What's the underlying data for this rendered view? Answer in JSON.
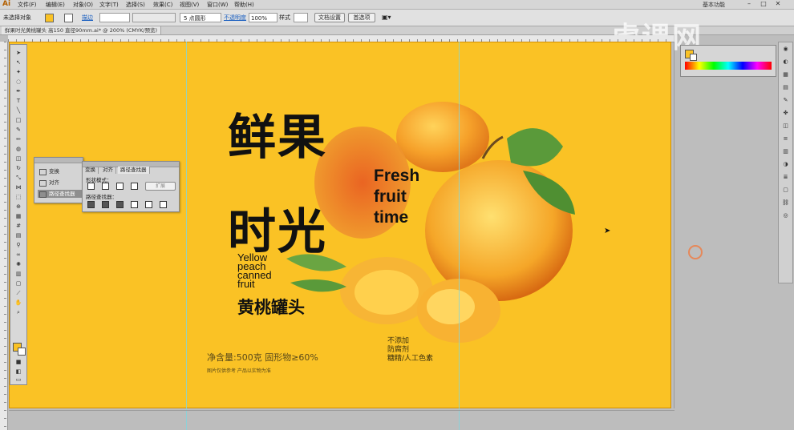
{
  "menubar": {
    "app_icon": "Ai",
    "menus": [
      "文件(F)",
      "编辑(E)",
      "对象(O)",
      "文字(T)",
      "选择(S)",
      "效果(C)",
      "视图(V)",
      "窗口(W)",
      "帮助(H)"
    ],
    "workspace": "基本功能"
  },
  "controlbar": {
    "selection_status": "未选择对象",
    "stroke_label": "描边",
    "point_size": "5 点圆形",
    "opacity_label": "不透明度",
    "opacity_value": "100%",
    "style_label": "样式",
    "doc_setup": "文档设置",
    "preferences": "首选项"
  },
  "document_tab": {
    "title": "鲜果时光黄桃罐头 高150 直径90mm.ai* @ 200% (CMYK/预览)"
  },
  "watermark": "虎课网",
  "transform_panel": {
    "items": [
      "变换",
      "对齐",
      "路径查找器"
    ],
    "selected_index": 2
  },
  "pathfinder_panel": {
    "tabs": [
      "变换",
      "对齐",
      "路径查找器"
    ],
    "active_tab": 2,
    "shape_modes_label": "形状模式：",
    "pathfinders_label": "路径查找器：",
    "expand_button": "扩展"
  },
  "artwork": {
    "title_cn_line1": "鲜果",
    "title_cn_line2": "时光",
    "title_en": [
      "Fresh",
      "fruit",
      "time"
    ],
    "subtitle_en": [
      "Yellow",
      "peach",
      "canned",
      "fruit"
    ],
    "subtitle_cn": "黄桃罐头",
    "net_weight": "净含量:500克     固形物≥60%",
    "disclaimer": "图片仅供参考 产品以实物为准",
    "no_additives": [
      "不添加",
      "防腐剂",
      "糖精/人工色素"
    ]
  },
  "colors": {
    "artboard": "#fac225",
    "peach": "#f5a623",
    "leaf": "#5a9a3a"
  }
}
